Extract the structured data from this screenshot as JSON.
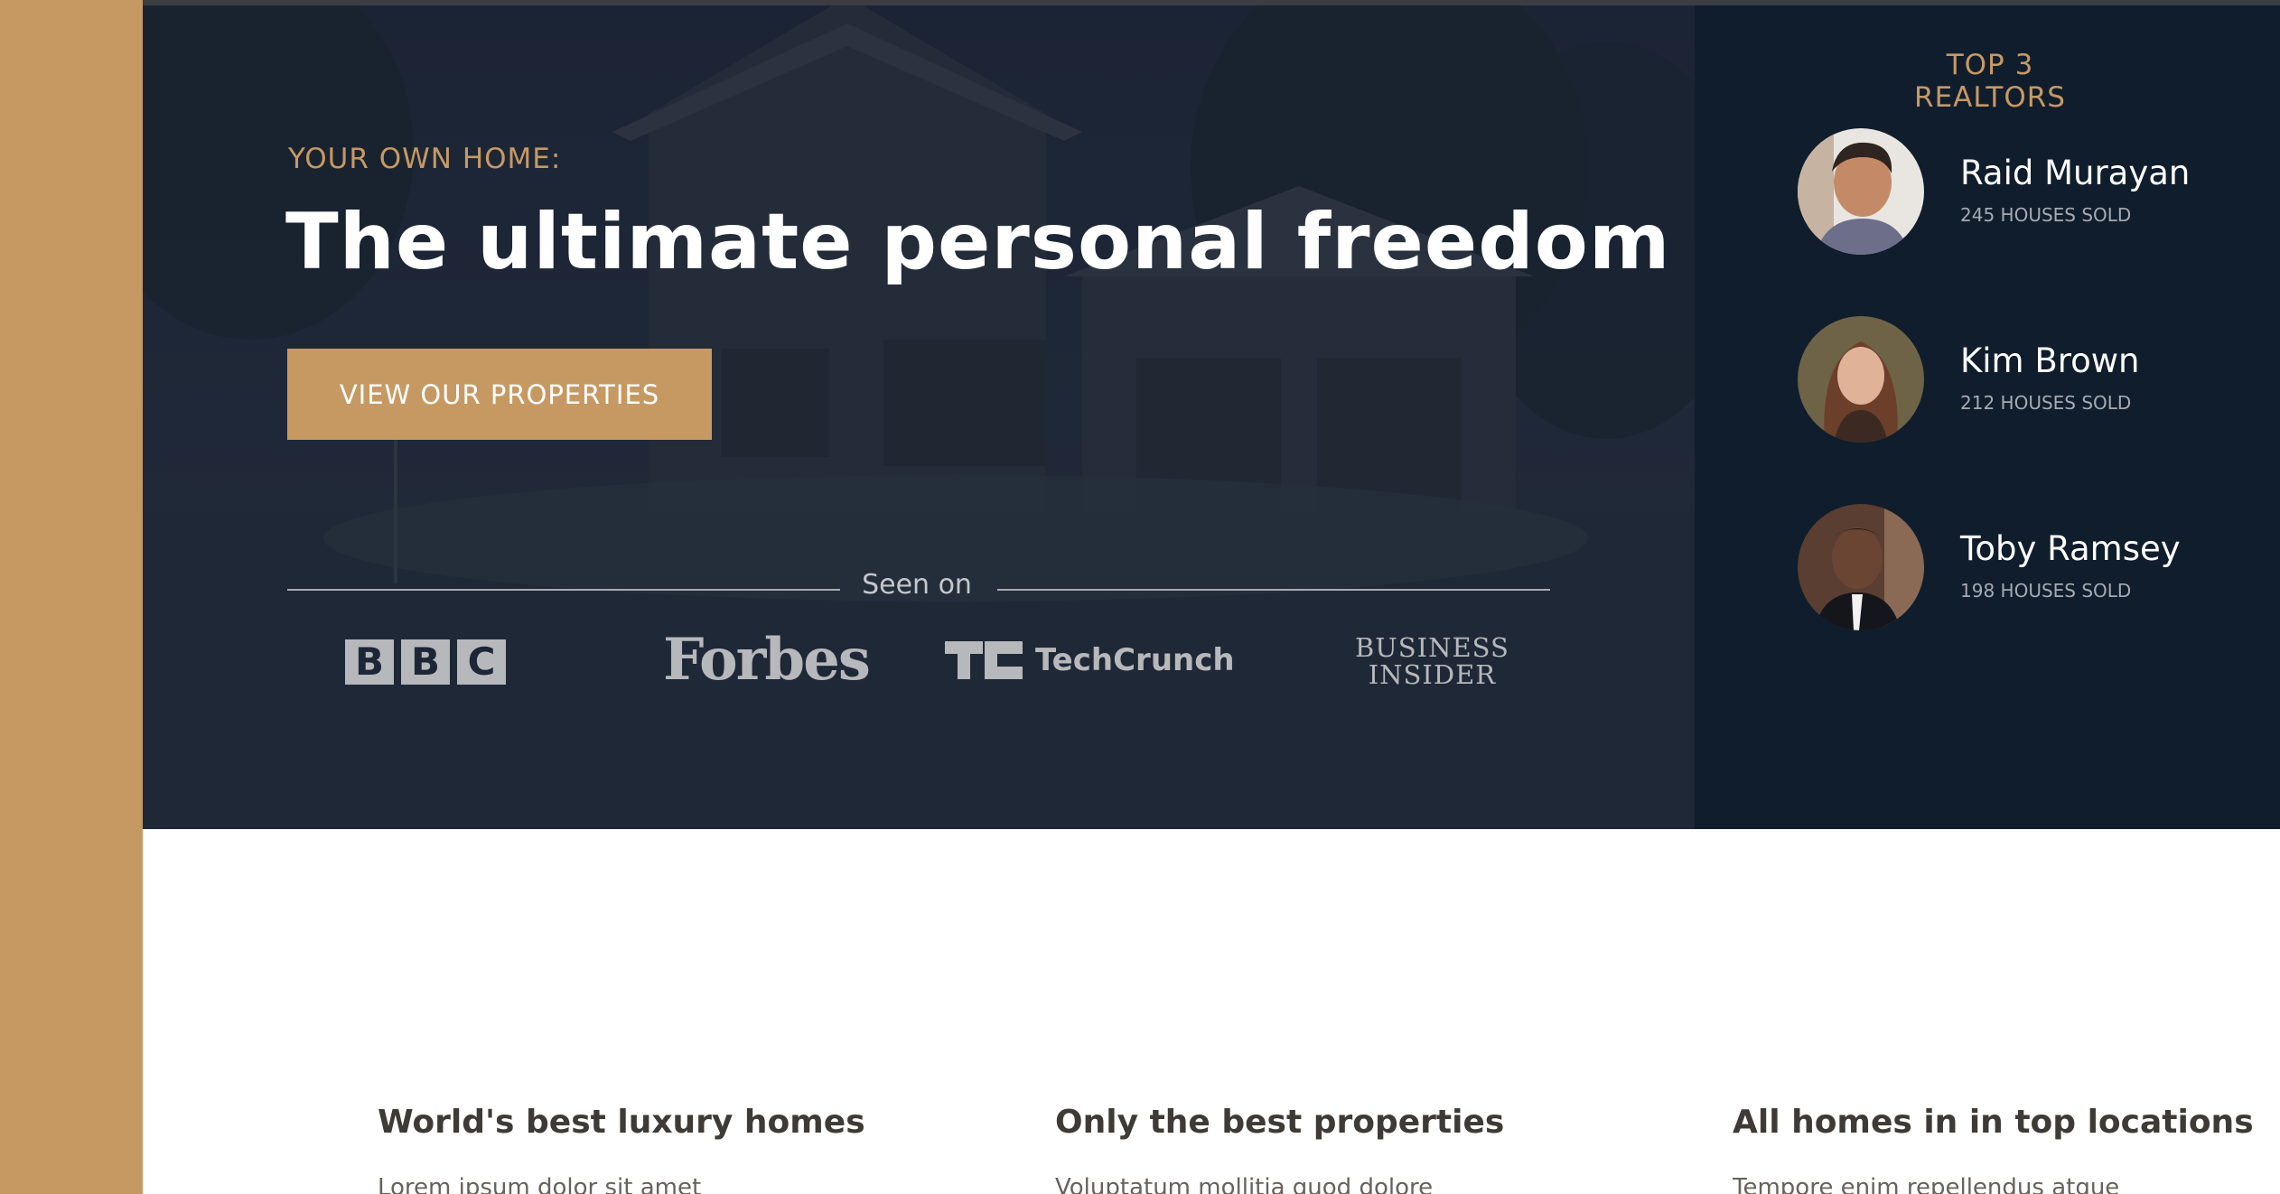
{
  "hero": {
    "eyebrow": "YOUR OWN HOME:",
    "headline": "The ultimate personal freedom",
    "cta_label": "VIEW OUR PROPERTIES",
    "seen_on": "Seen on",
    "logos": {
      "bbc": [
        "B",
        "B",
        "C"
      ],
      "forbes": "Forbes",
      "techcrunch": "TechCrunch",
      "business_insider_line1": "BUSINESS",
      "business_insider_line2": "INSIDER"
    }
  },
  "sidebar": {
    "title": "TOP 3 REALTORS",
    "realtors": [
      {
        "name": "Raid Murayan",
        "sold": "245 HOUSES SOLD"
      },
      {
        "name": "Kim Brown",
        "sold": "212 HOUSES SOLD"
      },
      {
        "name": "Toby Ramsey",
        "sold": "198 HOUSES SOLD"
      }
    ]
  },
  "features": [
    {
      "title": "World's best luxury homes",
      "body": "Lorem ipsum dolor sit amet"
    },
    {
      "title": "Only the best properties",
      "body": "Voluptatum mollitia quod dolore"
    },
    {
      "title": "All homes in in top locations",
      "body": "Tempore enim repellendus atque"
    }
  ],
  "colors": {
    "accent": "#c69963",
    "hero_dark": "#1c2536",
    "sidebar_dark": "#101d2c",
    "text_light": "#ffffff",
    "muted": "#a6abb2"
  },
  "icons": [
    "bbc-logo",
    "forbes-logo",
    "techcrunch-logo",
    "business-insider-logo",
    "realtor-avatar"
  ]
}
